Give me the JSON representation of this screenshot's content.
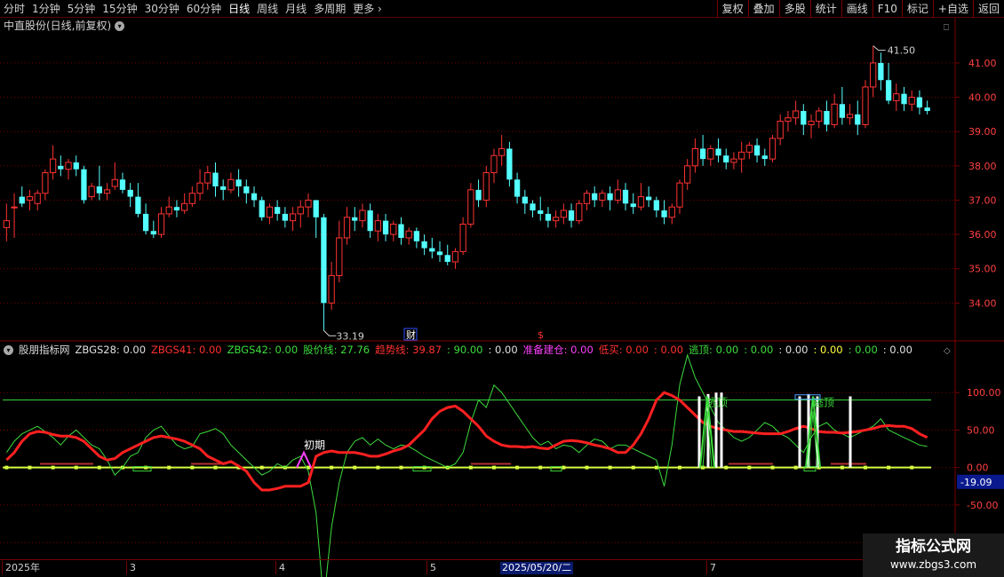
{
  "toolbar": {
    "periods": [
      "分时",
      "1分钟",
      "5分钟",
      "15分钟",
      "30分钟",
      "60分钟",
      "日线",
      "周线",
      "月线",
      "多周期",
      "更多"
    ],
    "active_index": 6,
    "buttons": [
      "复权",
      "叠加",
      "多股",
      "统计",
      "画线",
      "F10",
      "标记",
      "+自选",
      "返回"
    ]
  },
  "price_pane": {
    "title": "中直股份(日线,前复权)",
    "high_label": "41.50",
    "low_label": "33.19",
    "y_ticks": [
      "41.00",
      "40.00",
      "39.00",
      "38.00",
      "37.00",
      "36.00",
      "35.00",
      "34.00"
    ],
    "marker_cai": "财",
    "marker_dollar": "$"
  },
  "indicator": {
    "name": "股朋指标网",
    "items": [
      {
        "text": "ZBGS28: 0.00",
        "color": "#e0e0e0"
      },
      {
        "text": "ZBGS41: 0.00",
        "color": "#ff3030"
      },
      {
        "text": "ZBGS42: 0.00",
        "color": "#3cdc3c"
      },
      {
        "text": "股价线: 27.76",
        "color": "#3cdc3c"
      },
      {
        "text": "趋势线: 39.87",
        "color": "#ff3030"
      },
      {
        "text": ": 90.00",
        "color": "#3cdc3c"
      },
      {
        "text": ": 0.00",
        "color": "#e0e0e0"
      },
      {
        "text": "准备建仓: 0.00",
        "color": "#ff40ff"
      },
      {
        "text": "低买: 0.00",
        "color": "#ff3030"
      },
      {
        "text": ": 0.00",
        "color": "#ff3030"
      },
      {
        "text": "逃顶: 0.00",
        "color": "#3cdc3c"
      },
      {
        "text": ": 0.00",
        "color": "#3cdc3c"
      },
      {
        "text": ": 0.00",
        "color": "#e0e0e0"
      },
      {
        "text": ": 0.00",
        "color": "#ffff40"
      },
      {
        "text": ": 0.00",
        "color": "#3cdc3c"
      },
      {
        "text": ": 0.00",
        "color": "#e0e0e0"
      }
    ],
    "y_ticks": [
      "100.00",
      "50.00",
      "0.00",
      "-50.00",
      "-100.00"
    ],
    "current_value": "-19.09",
    "annotations": {
      "chuqi": "初期",
      "taoding1": "逃顶",
      "taoding2": "逃顶"
    }
  },
  "time_axis": {
    "labels": [
      "2025年",
      "3",
      "4",
      "5",
      "7"
    ],
    "highlight_date": "2025/05/20/二"
  },
  "watermark": {
    "title": "指标公式网",
    "url": "www.zbgs3.com"
  },
  "colors": {
    "up": "#ff3232",
    "down": "#54ffff",
    "grid": "#7a0000",
    "trend": "#ff2020",
    "price_line": "#3cdc3c"
  },
  "chart_data": {
    "type": "candlestick",
    "y_range": [
      33.0,
      41.8
    ],
    "candles": [
      [
        36.2,
        36.9,
        36.4,
        35.8
      ],
      [
        36.8,
        37.2,
        36.8,
        35.9
      ],
      [
        37.1,
        37.4,
        36.9,
        36.8
      ],
      [
        37.0,
        37.3,
        37.1,
        36.7
      ],
      [
        36.9,
        37.3,
        37.2,
        36.7
      ],
      [
        37.2,
        37.9,
        37.8,
        37.0
      ],
      [
        37.8,
        38.6,
        38.2,
        37.6
      ],
      [
        38.0,
        38.3,
        37.9,
        37.7
      ],
      [
        37.9,
        38.2,
        38.1,
        37.6
      ],
      [
        38.1,
        38.3,
        37.9,
        37.7
      ],
      [
        37.9,
        38.0,
        37.0,
        36.9
      ],
      [
        37.1,
        37.5,
        37.4,
        37.0
      ],
      [
        37.4,
        38.0,
        37.2,
        37.0
      ],
      [
        37.2,
        37.5,
        37.3,
        37.0
      ],
      [
        37.4,
        38.1,
        37.6,
        37.3
      ],
      [
        37.6,
        37.8,
        37.3,
        37.2
      ],
      [
        37.3,
        37.5,
        37.1,
        36.8
      ],
      [
        37.1,
        37.5,
        36.6,
        36.5
      ],
      [
        36.6,
        36.9,
        36.1,
        36.0
      ],
      [
        36.1,
        36.4,
        36.0,
        35.9
      ],
      [
        36.0,
        36.8,
        36.6,
        35.9
      ],
      [
        36.6,
        37.1,
        36.8,
        36.5
      ],
      [
        36.8,
        37.0,
        36.7,
        36.5
      ],
      [
        36.7,
        37.2,
        36.9,
        36.6
      ],
      [
        36.9,
        37.4,
        37.2,
        36.8
      ],
      [
        37.2,
        37.9,
        37.5,
        37.0
      ],
      [
        37.5,
        38.0,
        37.8,
        37.3
      ],
      [
        37.8,
        38.1,
        37.4,
        37.1
      ],
      [
        37.4,
        37.6,
        37.3,
        37.0
      ],
      [
        37.3,
        37.8,
        37.6,
        37.2
      ],
      [
        37.6,
        37.9,
        37.4,
        37.1
      ],
      [
        37.4,
        37.6,
        37.2,
        36.9
      ],
      [
        37.2,
        37.4,
        37.0,
        36.8
      ],
      [
        37.0,
        37.1,
        36.5,
        36.4
      ],
      [
        36.5,
        36.9,
        36.8,
        36.3
      ],
      [
        36.8,
        37.0,
        36.6,
        36.4
      ],
      [
        36.6,
        36.8,
        36.4,
        36.2
      ],
      [
        36.4,
        36.8,
        36.6,
        36.1
      ],
      [
        36.6,
        37.0,
        36.8,
        36.2
      ],
      [
        36.8,
        37.2,
        37.0,
        36.5
      ],
      [
        37.0,
        37.0,
        36.5,
        35.9
      ],
      [
        36.5,
        36.6,
        34.0,
        33.2
      ],
      [
        34.0,
        35.2,
        34.8,
        33.8
      ],
      [
        34.8,
        36.4,
        35.9,
        34.6
      ],
      [
        35.9,
        36.8,
        36.5,
        35.7
      ],
      [
        36.5,
        36.8,
        36.4,
        36.1
      ],
      [
        36.4,
        36.9,
        36.7,
        36.2
      ],
      [
        36.7,
        36.9,
        36.1,
        35.9
      ],
      [
        36.1,
        36.6,
        36.4,
        35.8
      ],
      [
        36.4,
        36.6,
        36.0,
        35.8
      ],
      [
        36.0,
        36.4,
        36.3,
        35.8
      ],
      [
        36.3,
        36.5,
        35.9,
        35.7
      ],
      [
        35.9,
        36.2,
        36.1,
        35.7
      ],
      [
        36.1,
        36.2,
        35.8,
        35.6
      ],
      [
        35.8,
        36.0,
        35.6,
        35.4
      ],
      [
        35.6,
        35.9,
        35.5,
        35.3
      ],
      [
        35.5,
        35.8,
        35.4,
        35.2
      ],
      [
        35.4,
        35.7,
        35.2,
        35.1
      ],
      [
        35.2,
        35.6,
        35.5,
        35.0
      ],
      [
        35.5,
        36.5,
        36.3,
        35.4
      ],
      [
        36.3,
        37.5,
        37.3,
        36.2
      ],
      [
        37.3,
        37.6,
        37.0,
        36.8
      ],
      [
        37.0,
        38.0,
        37.8,
        36.8
      ],
      [
        37.8,
        38.5,
        38.3,
        37.5
      ],
      [
        38.3,
        38.9,
        38.5,
        38.0
      ],
      [
        38.5,
        38.7,
        37.6,
        37.4
      ],
      [
        37.6,
        37.8,
        37.1,
        36.9
      ],
      [
        37.1,
        37.3,
        36.9,
        36.6
      ],
      [
        36.9,
        37.0,
        36.7,
        36.5
      ],
      [
        36.7,
        37.1,
        36.6,
        36.4
      ],
      [
        36.6,
        36.8,
        36.4,
        36.2
      ],
      [
        36.4,
        36.7,
        36.5,
        36.2
      ],
      [
        36.5,
        36.9,
        36.7,
        36.3
      ],
      [
        36.7,
        36.9,
        36.4,
        36.2
      ],
      [
        36.4,
        37.0,
        36.9,
        36.3
      ],
      [
        36.9,
        37.3,
        37.2,
        36.7
      ],
      [
        37.2,
        37.4,
        37.0,
        36.8
      ],
      [
        37.0,
        37.3,
        37.2,
        36.8
      ],
      [
        37.2,
        37.4,
        37.0,
        36.7
      ],
      [
        37.0,
        37.6,
        37.3,
        36.9
      ],
      [
        37.3,
        37.5,
        36.9,
        36.7
      ],
      [
        36.9,
        37.2,
        36.8,
        36.6
      ],
      [
        36.8,
        37.5,
        37.1,
        36.7
      ],
      [
        37.1,
        37.4,
        37.0,
        36.8
      ],
      [
        37.0,
        37.1,
        36.7,
        36.5
      ],
      [
        36.7,
        37.0,
        36.5,
        36.3
      ],
      [
        36.5,
        36.9,
        36.8,
        36.3
      ],
      [
        36.8,
        37.6,
        37.5,
        36.6
      ],
      [
        37.5,
        38.2,
        38.0,
        37.3
      ],
      [
        38.0,
        38.8,
        38.5,
        37.8
      ],
      [
        38.5,
        38.9,
        38.2,
        38.0
      ],
      [
        38.2,
        38.6,
        38.5,
        38.0
      ],
      [
        38.5,
        38.8,
        38.3,
        38.1
      ],
      [
        38.3,
        38.5,
        38.1,
        37.9
      ],
      [
        38.1,
        38.4,
        38.2,
        37.9
      ],
      [
        38.2,
        38.7,
        38.4,
        37.8
      ],
      [
        38.4,
        38.7,
        38.6,
        38.2
      ],
      [
        38.6,
        38.8,
        38.3,
        38.1
      ],
      [
        38.3,
        38.5,
        38.2,
        38.0
      ],
      [
        38.2,
        38.9,
        38.8,
        38.1
      ],
      [
        38.8,
        39.5,
        39.3,
        38.6
      ],
      [
        39.3,
        39.6,
        39.4,
        39.0
      ],
      [
        39.4,
        39.9,
        39.6,
        39.2
      ],
      [
        39.6,
        39.8,
        39.2,
        38.9
      ],
      [
        39.2,
        39.5,
        39.3,
        38.8
      ],
      [
        39.3,
        39.7,
        39.6,
        39.1
      ],
      [
        39.6,
        39.9,
        39.2,
        39.0
      ],
      [
        39.2,
        40.1,
        39.8,
        39.1
      ],
      [
        39.8,
        40.3,
        39.4,
        39.2
      ],
      [
        39.4,
        39.8,
        39.5,
        39.2
      ],
      [
        39.5,
        39.9,
        39.2,
        38.9
      ],
      [
        39.2,
        40.5,
        40.3,
        39.1
      ],
      [
        40.3,
        41.5,
        41.0,
        40.0
      ],
      [
        41.0,
        41.3,
        40.5,
        40.2
      ],
      [
        40.5,
        41.0,
        39.9,
        39.8
      ],
      [
        39.9,
        40.4,
        40.1,
        39.6
      ],
      [
        40.1,
        40.3,
        39.8,
        39.6
      ],
      [
        39.8,
        40.2,
        40.0,
        39.6
      ],
      [
        40.0,
        40.2,
        39.7,
        39.5
      ],
      [
        39.7,
        39.9,
        39.6,
        39.5
      ]
    ],
    "indicator_range": [
      -120,
      150
    ],
    "price_line": [
      20,
      35,
      45,
      50,
      55,
      48,
      40,
      30,
      42,
      50,
      40,
      30,
      25,
      10,
      -10,
      0,
      15,
      20,
      40,
      50,
      55,
      42,
      30,
      25,
      28,
      45,
      48,
      52,
      45,
      30,
      20,
      10,
      0,
      -10,
      -5,
      5,
      0,
      10,
      15,
      -5,
      -60,
      -180,
      -80,
      -20,
      20,
      35,
      40,
      30,
      38,
      30,
      25,
      30,
      28,
      22,
      15,
      10,
      5,
      0,
      5,
      20,
      60,
      90,
      80,
      110,
      100,
      85,
      70,
      55,
      40,
      30,
      35,
      25,
      30,
      28,
      20,
      30,
      38,
      35,
      25,
      30,
      30,
      25,
      20,
      15,
      10,
      -25,
      30,
      110,
      150,
      120,
      100,
      80,
      60,
      50,
      40,
      35,
      40,
      50,
      60,
      55,
      45,
      40,
      30,
      20,
      40,
      55,
      60,
      50,
      45,
      40,
      45,
      50,
      55,
      65,
      50,
      45,
      40,
      35,
      30,
      28
    ],
    "trend_line": [
      10,
      20,
      35,
      45,
      48,
      47,
      44,
      42,
      42,
      40,
      35,
      25,
      15,
      10,
      12,
      20,
      25,
      30,
      35,
      40,
      42,
      40,
      38,
      35,
      30,
      25,
      15,
      10,
      5,
      8,
      2,
      -5,
      -20,
      -30,
      -30,
      -28,
      -25,
      -25,
      -25,
      -20,
      15,
      20,
      22,
      20,
      20,
      20,
      18,
      15,
      15,
      18,
      22,
      25,
      30,
      40,
      50,
      65,
      75,
      80,
      82,
      75,
      65,
      55,
      42,
      35,
      30,
      28,
      28,
      27,
      28,
      26,
      25,
      30,
      35,
      36,
      35,
      33,
      30,
      28,
      25,
      20,
      20,
      30,
      45,
      65,
      90,
      100,
      96,
      90,
      80,
      70,
      60,
      55,
      52,
      50,
      48,
      48,
      47,
      46,
      45,
      45,
      45,
      48,
      52,
      55,
      52,
      48,
      47,
      47,
      46,
      47,
      48,
      50,
      52,
      55,
      56,
      55,
      55,
      52,
      45,
      40
    ]
  }
}
